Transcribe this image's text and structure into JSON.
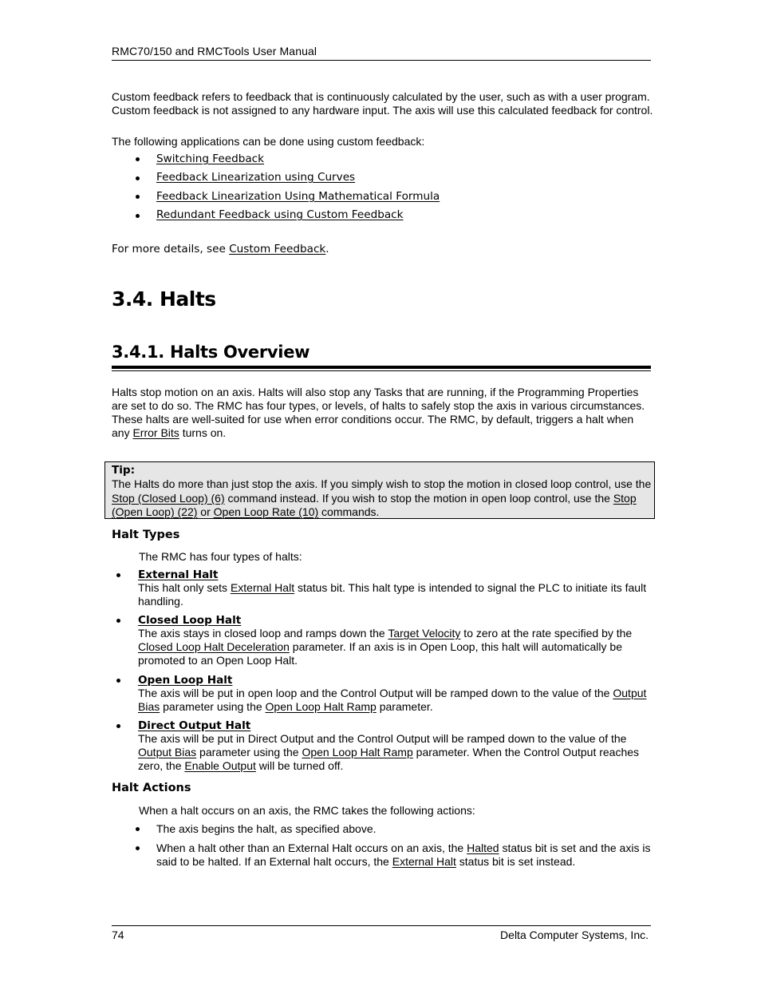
{
  "header": {
    "title": "RMC70/150 and RMCTools User Manual"
  },
  "intro": {
    "paragraph": "Custom feedback refers to feedback that is continuously calculated by the user, such as with a user program. Custom feedback is not assigned to any hardware input. The axis will use this calculated feedback for control.",
    "list_lead": "The following applications can be done using custom feedback:",
    "applications": [
      {
        "label": "Switching Feedback"
      },
      {
        "label": "Feedback Linearization using Curves"
      },
      {
        "label": "Feedback Linearization Using Mathematical Formula"
      },
      {
        "label": "Redundant Feedback using Custom Feedback"
      }
    ],
    "more_prefix": "For more details, see ",
    "more_link": "Custom Feedback",
    "more_suffix": "."
  },
  "section": {
    "title": "3.4. Halts"
  },
  "subsection": {
    "title": "3.4.1. Halts Overview"
  },
  "overview": {
    "text_1": "Halts stop motion on an axis. Halts will also stop any Tasks that are running, if the Programming Properties are set to do so. The RMC has four types, or levels, of halts to safely stop the axis in various circumstances. These halts are well-suited for use when error conditions occur. The RMC, by default, triggers a halt when any ",
    "link": "Error Bits",
    "text_2": " turns on."
  },
  "tip": {
    "title": "Tip:",
    "text_1": "The Halts do more than just stop the axis. If you simply wish to stop the motion in closed loop control, use the ",
    "link_1": "Stop (Closed Loop) (6)",
    "text_2": " command instead. If you wish to stop the motion in open loop control, use the ",
    "link_2": "Stop (Open Loop) (22)",
    "text_3": " or ",
    "link_3": "Open Loop Rate (10)",
    "text_4": " commands."
  },
  "halt_types": {
    "heading": "Halt Types",
    "lead": "The RMC has four types of halts:",
    "items": [
      {
        "title": "External Halt",
        "parts": [
          "This halt only sets ",
          "External Halt",
          " status bit. This halt type is intended to signal the PLC to initiate its fault handling."
        ]
      },
      {
        "title": "Closed Loop Halt",
        "parts": [
          "The axis stays in closed loop and ramps down the ",
          "Target Velocity",
          " to zero at the rate specified by the ",
          "Closed Loop Halt Deceleration",
          " parameter. If an axis is in Open Loop, this halt will automatically be promoted to an Open Loop Halt."
        ]
      },
      {
        "title": "Open Loop Halt",
        "parts": [
          "The axis will be put in open loop and the Control Output will be ramped down to the value of the ",
          "Output Bias",
          " parameter using the ",
          "Open Loop Halt Ramp",
          " parameter."
        ]
      },
      {
        "title": "Direct Output Halt",
        "parts": [
          "The axis will be put in Direct Output and the Control Output will be ramped down to the value of the ",
          "Output Bias",
          " parameter using the ",
          "Open Loop Halt Ramp",
          " parameter. When the Control Output reaches zero, the ",
          "Enable Output",
          " will be turned off."
        ]
      }
    ]
  },
  "halt_actions": {
    "heading": "Halt Actions",
    "lead": "When a halt occurs on an axis, the RMC takes the following actions:",
    "items": [
      {
        "parts": [
          "The axis begins the halt, as specified above."
        ]
      },
      {
        "parts": [
          "When a halt other than an External Halt occurs on an axis, the ",
          "Halted",
          " status bit is set and the axis is said to be halted. If an External halt occurs, the ",
          "External Halt",
          " status bit is set instead."
        ]
      }
    ]
  },
  "footer": {
    "page_number": "74",
    "company": "Delta Computer Systems, Inc."
  }
}
